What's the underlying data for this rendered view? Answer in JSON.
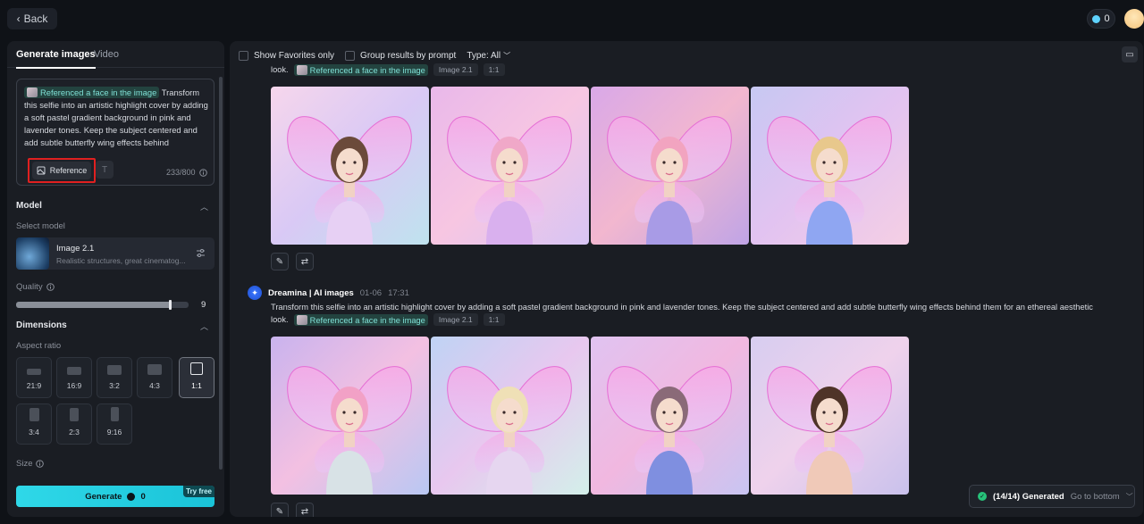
{
  "topbar": {
    "back_label": "Back",
    "credits": "0"
  },
  "left_panel": {
    "tabs": [
      "Generate images",
      "Video"
    ],
    "prompt": {
      "reference_chip": "Referenced a face in the image",
      "text": "Transform this selfie into an artistic highlight cover by adding a soft pastel gradient background in pink and lavender tones. Keep the subject centered and add subtle butterfly wing effects behind",
      "reference_button": "Reference",
      "counter": "233/800"
    },
    "model": {
      "section_title": "Model",
      "select_label": "Select model",
      "name": "Image 2.1",
      "description": "Realistic structures, great cinematog..."
    },
    "quality": {
      "label": "Quality",
      "value": "9",
      "level_fraction": 0.9
    },
    "dimensions": {
      "section_title": "Dimensions",
      "aspect_label": "Aspect ratio",
      "ratios": [
        "21:9",
        "16:9",
        "3:2",
        "4:3",
        "1:1",
        "3:4",
        "2:3",
        "9:16"
      ],
      "selected": "1:1",
      "size_label": "Size"
    },
    "generate": {
      "label": "Generate",
      "cost": "0",
      "badge": "Try free"
    }
  },
  "right_panel": {
    "filters": {
      "show_favorites": "Show Favorites only",
      "group_results": "Group results by prompt",
      "type": "Type: All"
    },
    "group1": {
      "tail_text": "look.",
      "chip": "Referenced a face in the image",
      "model_pill": "Image 2.1",
      "ratio_pill": "1:1"
    },
    "group2": {
      "author": "Dreamina | AI images",
      "date": "01-06",
      "time": "17:31",
      "prompt": "Transform this selfie into an artistic highlight cover by adding a soft pastel gradient background in pink and lavender tones. Keep the subject centered and add subtle butterfly wing effects behind them for an ethereal aesthetic",
      "tail_text": "look.",
      "chip": "Referenced a face in the image",
      "model_pill": "Image 2.1",
      "ratio_pill": "1:1"
    },
    "toast": {
      "generated": "(14/14) Generated",
      "goto": "Go to bottom"
    }
  },
  "colors": {
    "accent": "#1ac3d8",
    "highlight_box": "#e02020",
    "chip_bg": "#23433f",
    "chip_text": "#7fe0d6"
  }
}
